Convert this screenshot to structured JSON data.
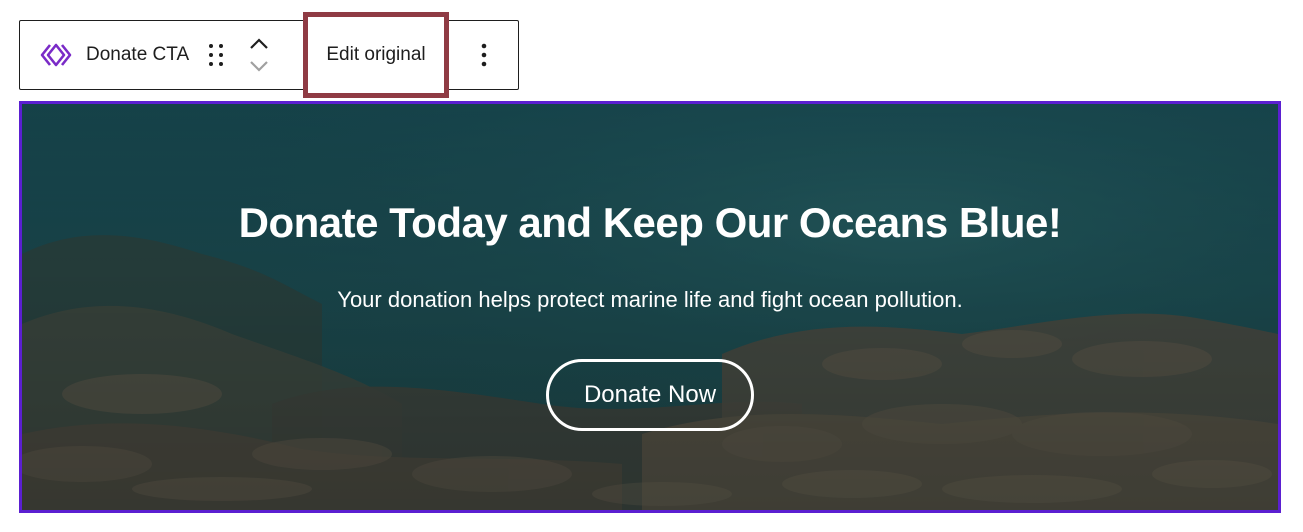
{
  "toolbar": {
    "block_name": "Donate CTA",
    "block_icon": "synced-pattern-icon",
    "edit_original_label": "Edit original",
    "more_options_icon": "vertical-ellipsis-icon",
    "drag_icon": "drag-handle-icon",
    "move_up_icon": "chevron-up-icon",
    "move_down_icon": "chevron-down-icon",
    "highlight_color": "#8f3b44",
    "icon_color": "#7a2bc7"
  },
  "cta": {
    "heading": "Donate Today and Keep Our Oceans Blue!",
    "subtext": "Your donation helps protect marine life and fight ocean pollution.",
    "button_label": "Donate Now",
    "border_color": "#5b1fd1",
    "background_image": "underwater-coral-reef"
  }
}
